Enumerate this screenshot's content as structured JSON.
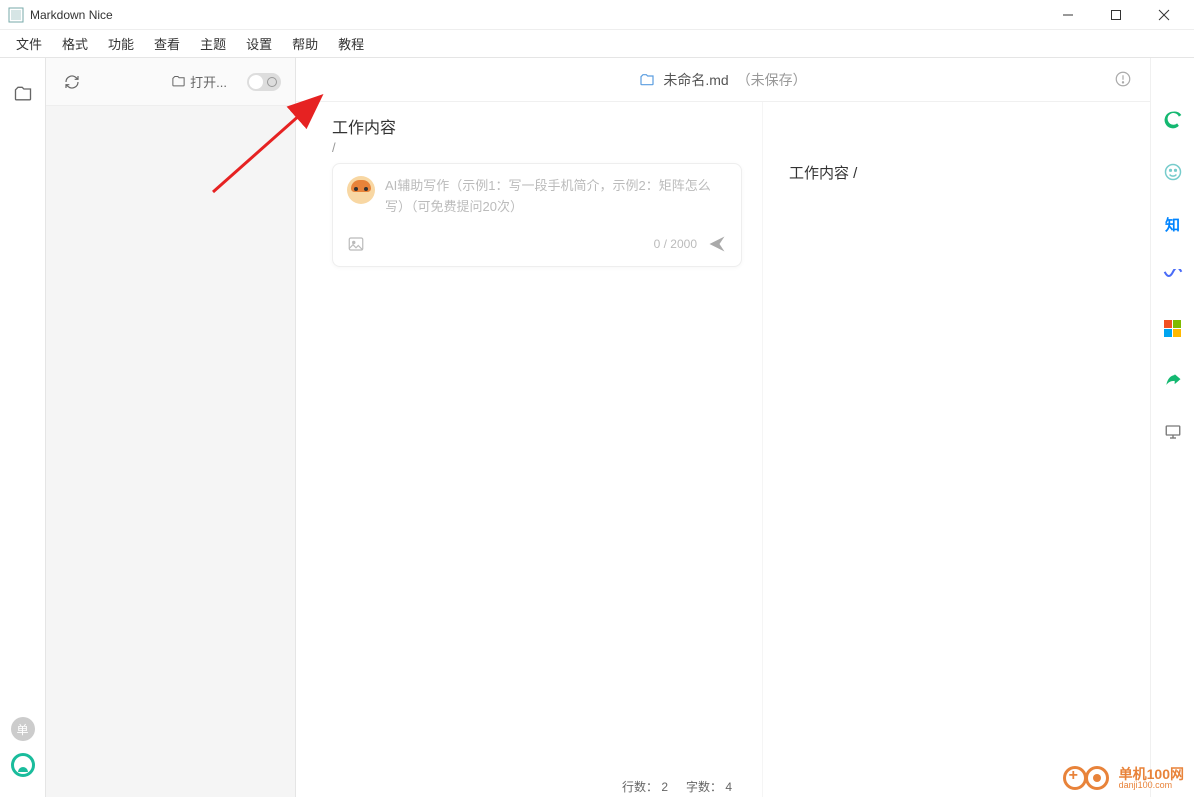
{
  "window": {
    "title": "Markdown Nice"
  },
  "menubar": [
    "文件",
    "格式",
    "功能",
    "查看",
    "主题",
    "设置",
    "帮助",
    "教程"
  ],
  "file_toolbar": {
    "open_label": "打开..."
  },
  "file_header": {
    "filename": "未命名.md",
    "status": "（未保存）"
  },
  "editor": {
    "title": "工作内容",
    "slash": "/",
    "ai_placeholder": "AI辅助写作（示例1：写一段手机简介，示例2：矩阵怎么写）（可免费提问20次）",
    "counter": "0 / 2000"
  },
  "preview": {
    "text": "工作内容 /"
  },
  "right_icons": {
    "zhihu": "知"
  },
  "left_badge": "单",
  "statusbar": {
    "rows_label": "行数：",
    "rows_val": "2",
    "chars_label": "字数：",
    "chars_val": "4"
  },
  "watermark": {
    "cn": "单机100网",
    "en": "danji100.com"
  }
}
